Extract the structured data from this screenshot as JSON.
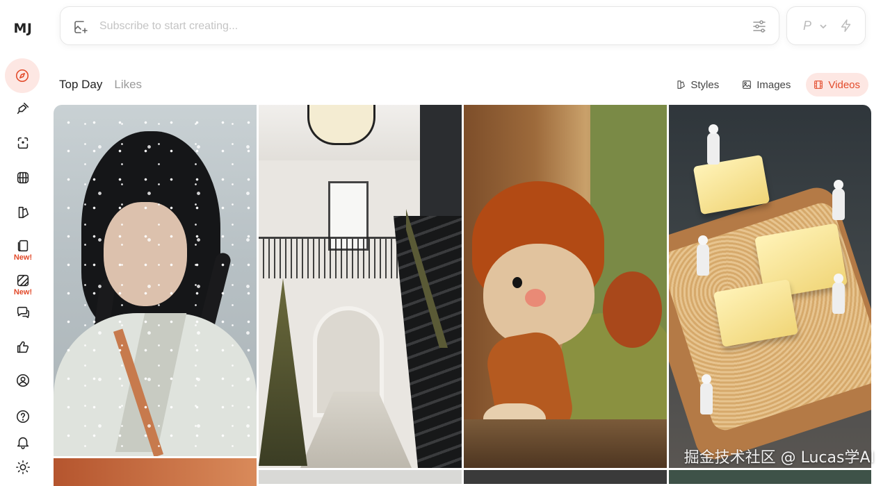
{
  "app": {
    "logo": "MJ"
  },
  "sidebar": {
    "items": [
      {
        "icon": "compass-icon",
        "active": true
      },
      {
        "icon": "brush-icon"
      },
      {
        "icon": "editor-icon"
      },
      {
        "icon": "globe-icon"
      },
      {
        "icon": "styles-icon"
      },
      {
        "icon": "cards-icon",
        "badge": "New!"
      },
      {
        "icon": "moodboard-icon",
        "badge": "New!"
      },
      {
        "icon": "chat-icon"
      },
      {
        "icon": "thumbs-up-icon"
      },
      {
        "icon": "profile-icon"
      },
      {
        "icon": "help-icon"
      },
      {
        "icon": "bell-icon"
      },
      {
        "icon": "sun-icon"
      }
    ]
  },
  "prompt": {
    "placeholder": "Subscribe to start creating..."
  },
  "mode": {
    "label": "P"
  },
  "tabs": [
    {
      "label": "Top Day",
      "active": true
    },
    {
      "label": "Likes",
      "active": false
    }
  ],
  "filters": [
    {
      "label": "Styles",
      "icon": "styles-icon",
      "active": false
    },
    {
      "label": "Images",
      "icon": "image-icon",
      "active": false
    },
    {
      "label": "Videos",
      "icon": "film-icon",
      "active": true
    }
  ],
  "gallery": {
    "items": [
      {
        "subject": "woman in snow"
      },
      {
        "subject": "staircase interior"
      },
      {
        "subject": "felt doll"
      },
      {
        "subject": "tiny chefs on bread"
      }
    ]
  },
  "watermark": "掘金技术社区 @ Lucas学AI",
  "colors": {
    "accent": "#e24a2a",
    "accent_bg": "#fde7e3"
  }
}
